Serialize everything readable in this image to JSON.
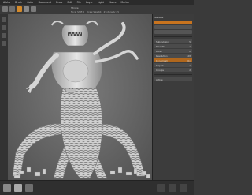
{
  "menu": [
    "Alpha",
    "Brush",
    "Color",
    "Document",
    "Draw",
    "Edit",
    "File",
    "Layer",
    "Light",
    "Macro",
    "Marker",
    "Material",
    "Movie",
    "Picker",
    "Preferences",
    "Render",
    "Stencil",
    "Stroke"
  ],
  "toolbar": {
    "stroke_label": "Stroke",
    "fields": [
      "Focal Shift 0",
      "Draw Size 64",
      "Z Intensity 25"
    ]
  },
  "panel": {
    "title": "Subtool",
    "rows": [
      {
        "label": "Subdivision",
        "value": "5"
      },
      {
        "label": "Smooth",
        "value": "1"
      },
      {
        "label": "Polish",
        "value": "0"
      },
      {
        "label": "Resolution",
        "value": "128"
      },
      {
        "label": "Dynamesh",
        "value": "On"
      },
      {
        "label": "Project",
        "value": "1"
      },
      {
        "label": "Groups",
        "value": "2"
      }
    ],
    "highlight_label": "Active"
  },
  "colors": {
    "accent": "#c8741f",
    "model": "#d8d8d8",
    "viewport_bg": "#6a6a6a"
  }
}
